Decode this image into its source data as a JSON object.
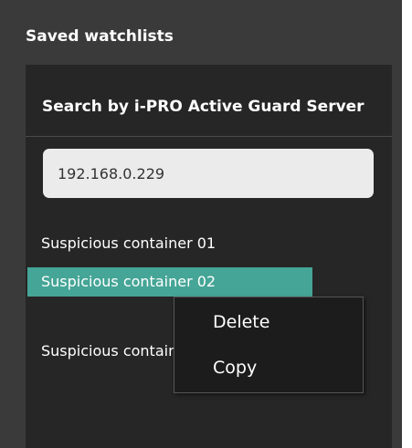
{
  "panel": {
    "title": "Saved watchlists"
  },
  "watchlist_panel": {
    "title": "Search by i-PRO Active Guard Server",
    "search_value": "192.168.0.229",
    "items": [
      {
        "label": "Suspicious container 01",
        "selected": false
      },
      {
        "label": "Suspicious container 02",
        "selected": true
      },
      {
        "label": "Suspicious container 03",
        "selected": false
      }
    ]
  },
  "context_menu": {
    "items": [
      {
        "label": "Delete"
      },
      {
        "label": "Copy"
      }
    ]
  },
  "colors": {
    "panel_bg": "#3a3a3a",
    "inner_bg": "#262626",
    "selected_bg": "#45a596",
    "input_bg": "#ebebeb",
    "menu_bg": "#1c1c1c"
  }
}
